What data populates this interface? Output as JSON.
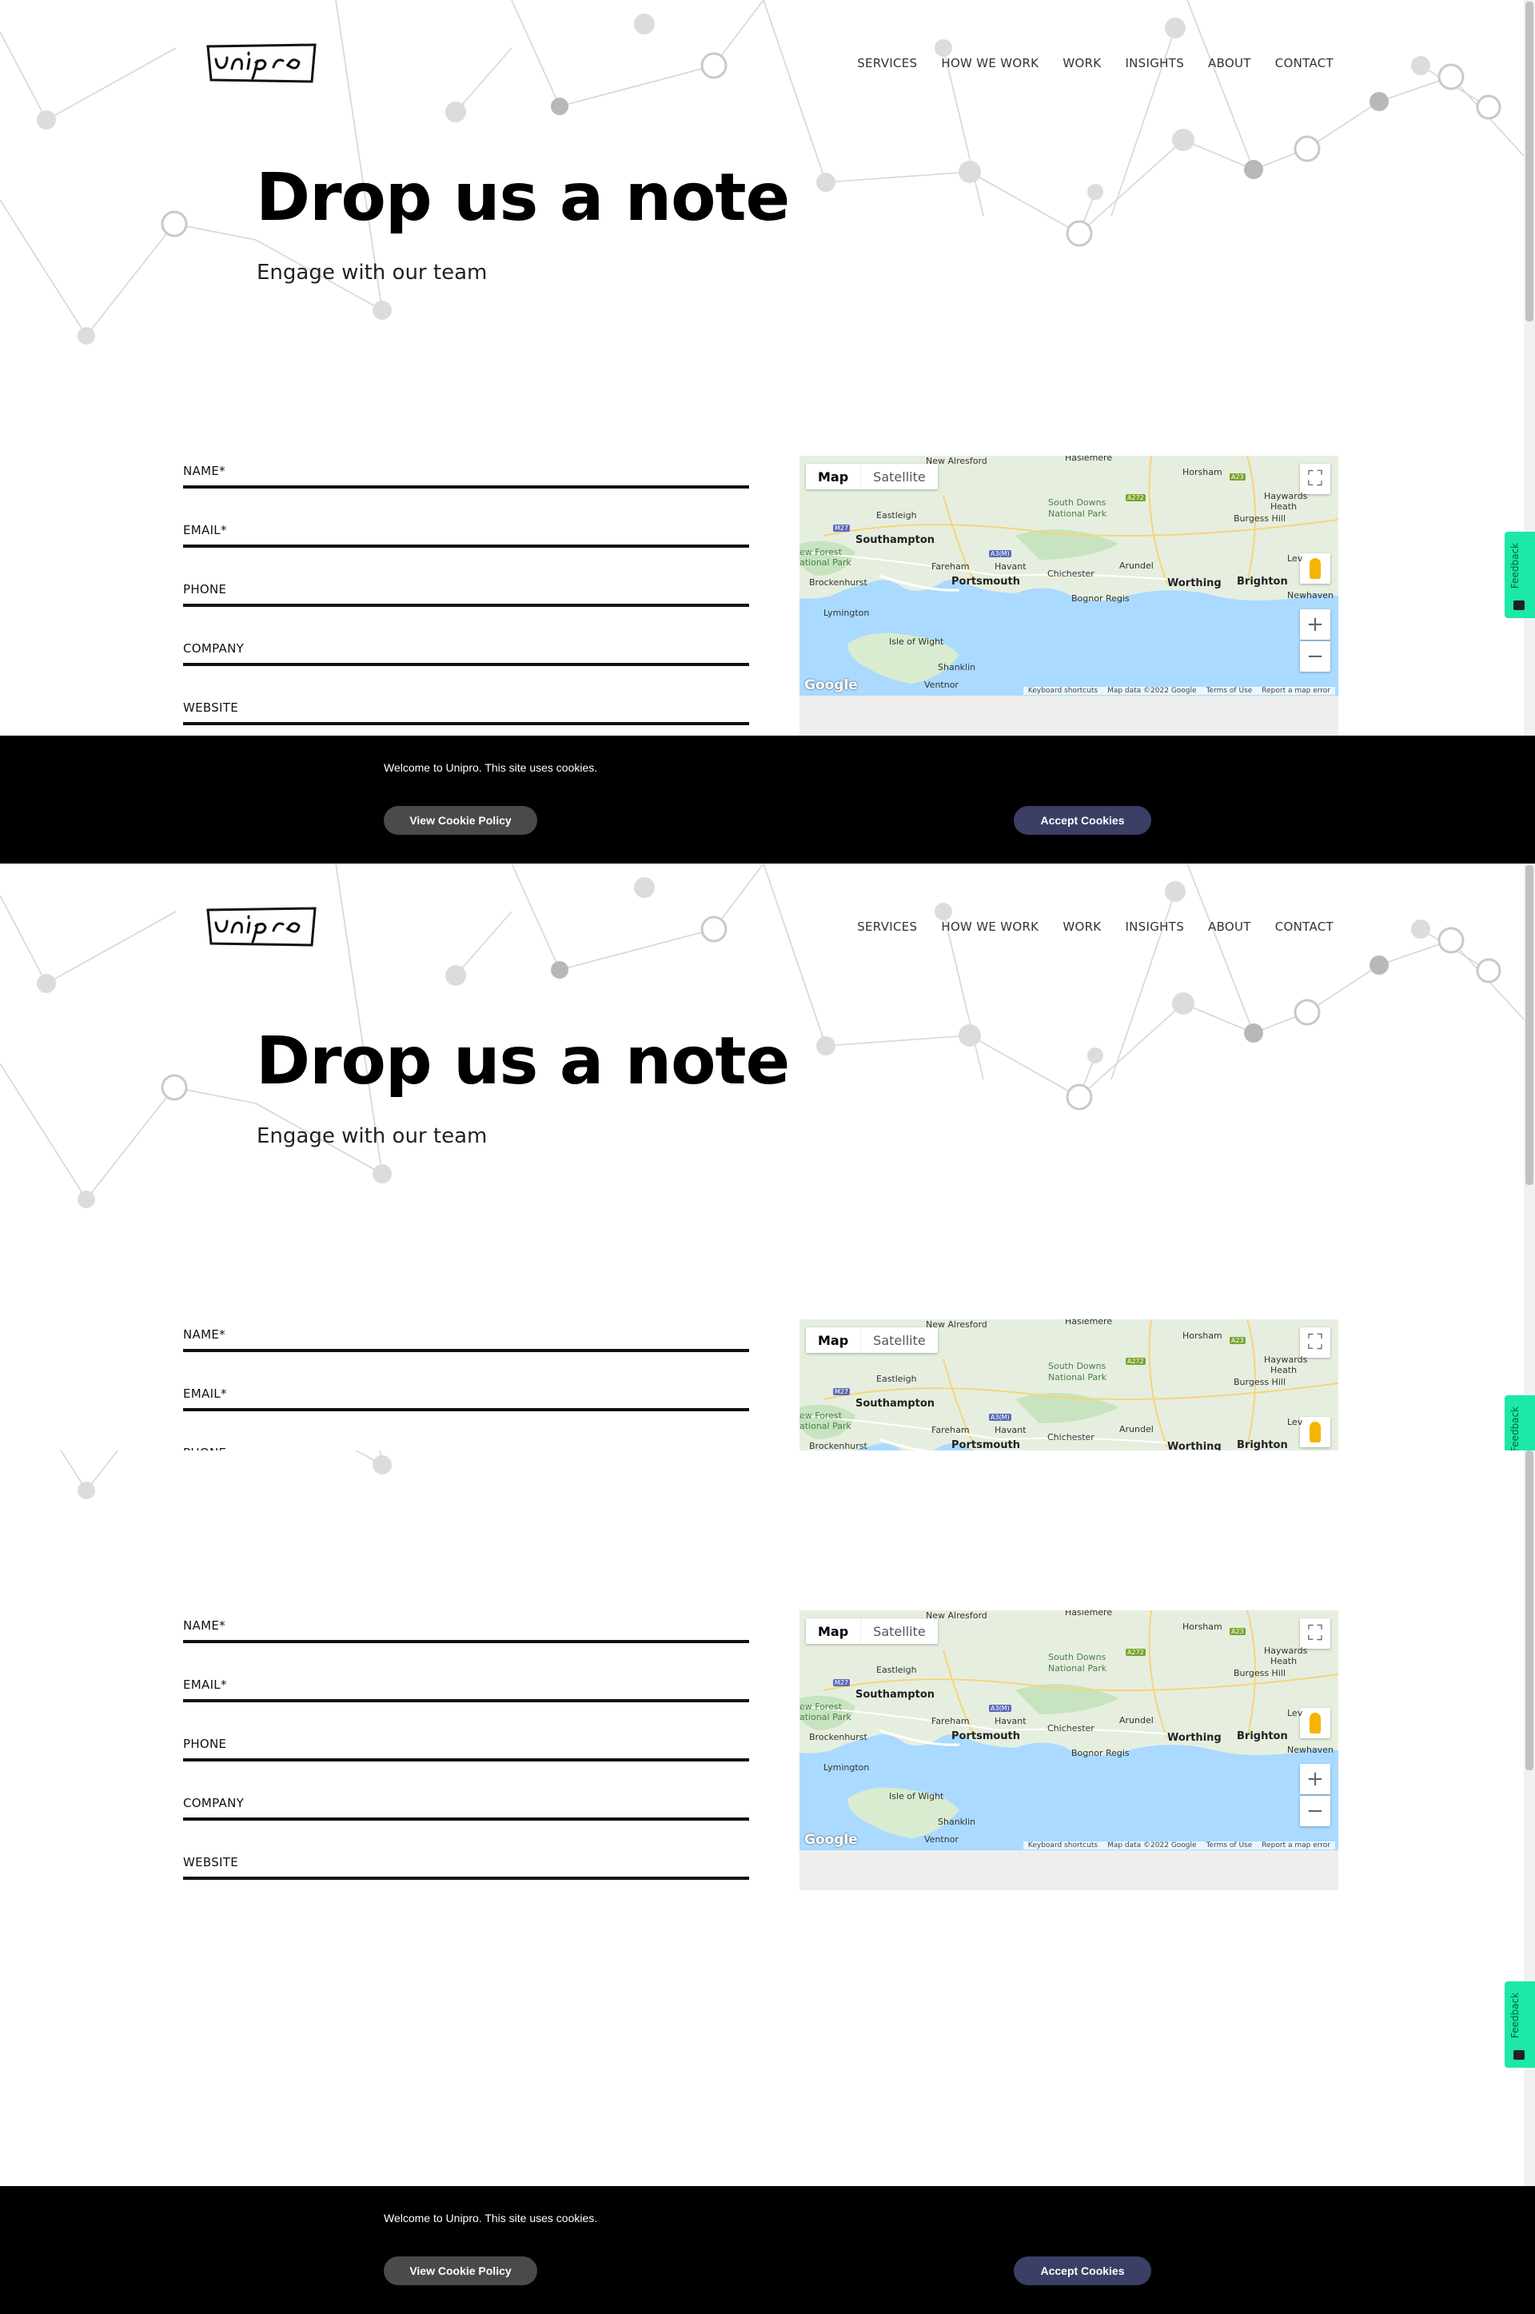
{
  "brand": {
    "logo_text": "Unipro"
  },
  "nav": {
    "items": [
      {
        "label": "SERVICES"
      },
      {
        "label": "HOW WE WORK"
      },
      {
        "label": "WORK"
      },
      {
        "label": "INSIGHTS"
      },
      {
        "label": "ABOUT"
      },
      {
        "label": "CONTACT"
      }
    ]
  },
  "hero": {
    "title": "Drop us a note",
    "subtitle": "Engage with our team"
  },
  "form": {
    "fields": [
      {
        "label": "NAME*"
      },
      {
        "label": "EMAIL*"
      },
      {
        "label": "PHONE"
      },
      {
        "label": "COMPANY"
      },
      {
        "label": "WEBSITE"
      }
    ]
  },
  "map": {
    "toggle": {
      "map": "Map",
      "satellite": "Satellite"
    },
    "fullscreen_icon": "fullscreen-icon",
    "pegman_icon": "pegman-icon",
    "zoom_in": "+",
    "zoom_out": "−",
    "logo": "Google",
    "terms": [
      "Keyboard shortcuts",
      "Map data ©2022 Google",
      "Terms of Use",
      "Report a map error"
    ],
    "places": [
      {
        "name": "New Alresford",
        "cls": ""
      },
      {
        "name": "Haslemere",
        "cls": ""
      },
      {
        "name": "Horsham",
        "cls": ""
      },
      {
        "name": "Eastleigh",
        "cls": ""
      },
      {
        "name": "South Downs",
        "cls": "park"
      },
      {
        "name": "National Park",
        "cls": "park"
      },
      {
        "name": "Haywards",
        "cls": ""
      },
      {
        "name": "Heath",
        "cls": ""
      },
      {
        "name": "Burgess Hill",
        "cls": ""
      },
      {
        "name": "Southampton",
        "cls": "big"
      },
      {
        "name": "ew Forest",
        "cls": "park"
      },
      {
        "name": "ational Park",
        "cls": "park"
      },
      {
        "name": "Fareham",
        "cls": ""
      },
      {
        "name": "Havant",
        "cls": ""
      },
      {
        "name": "Chichester",
        "cls": ""
      },
      {
        "name": "Arundel",
        "cls": ""
      },
      {
        "name": "Lev",
        "cls": ""
      },
      {
        "name": "Brockenhurst",
        "cls": ""
      },
      {
        "name": "Portsmouth",
        "cls": "big"
      },
      {
        "name": "Worthing",
        "cls": "big"
      },
      {
        "name": "Brighton",
        "cls": "big"
      },
      {
        "name": "Bognor Regis",
        "cls": ""
      },
      {
        "name": "Newhaven",
        "cls": ""
      },
      {
        "name": "Lymington",
        "cls": ""
      },
      {
        "name": "Isle of Wight",
        "cls": ""
      },
      {
        "name": "Shanklin",
        "cls": ""
      },
      {
        "name": "Ventnor",
        "cls": ""
      }
    ],
    "roads": [
      "M27",
      "A3(M)",
      "A272",
      "A23"
    ]
  },
  "cookie": {
    "message": "Welcome to Unipro. This site uses cookies.",
    "view_label": "View Cookie Policy",
    "accept_label": "Accept Cookies"
  },
  "feedback": {
    "label": "Feedback"
  },
  "colors": {
    "accept": "#3b3f66",
    "view": "#4a4a4a",
    "feedback": "#1ce8a8",
    "water": "#aadaff",
    "land": "#e8f0e2"
  }
}
